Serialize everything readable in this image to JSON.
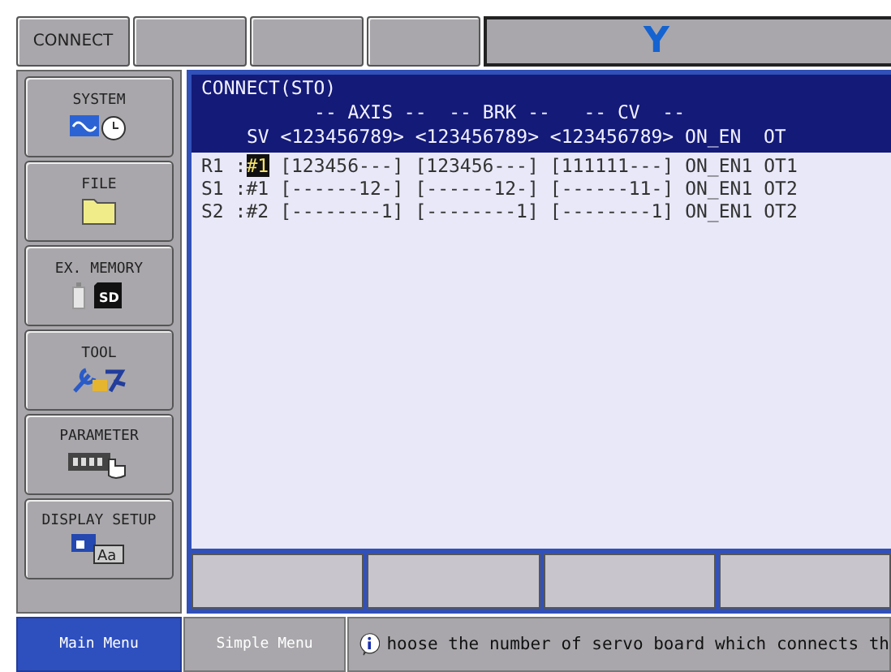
{
  "top_bar": {
    "connect_button": "CONNECT",
    "title": "Y"
  },
  "menu": [
    {
      "label": "SYSTEM",
      "kind": "system"
    },
    {
      "label": "FILE",
      "kind": "file"
    },
    {
      "label": "EX. MEMORY",
      "kind": "memory",
      "icon_text": "SD"
    },
    {
      "label": "TOOL",
      "kind": "tool"
    },
    {
      "label": "PARAMETER",
      "kind": "parameter"
    },
    {
      "label": "DISPLAY SETUP",
      "kind": "display",
      "icon_text": "Aa"
    }
  ],
  "panel": {
    "title": "CONNECT(STO)",
    "header_groups": "-- AXIS --  -- BRK --   -- CV  --",
    "header_columns": "SV <123456789> <123456789> <123456789> ON_EN  OT",
    "rows": [
      {
        "robot": "R1 :",
        "sv": "#1",
        "axis": "[123456---]",
        "brk": "[123456---]",
        "cv": "[111111---]",
        "on_en": "ON_EN1",
        "ot": "OT1",
        "selected": true
      },
      {
        "robot": "S1 :",
        "sv": "#1",
        "axis": "[------12-]",
        "brk": "[------12-]",
        "cv": "[------11-]",
        "on_en": "ON_EN1",
        "ot": "OT2",
        "selected": false
      },
      {
        "robot": "S2 :",
        "sv": "#2",
        "axis": "[--------1]",
        "brk": "[--------1]",
        "cv": "[--------1]",
        "on_en": "ON_EN1",
        "ot": "OT2",
        "selected": false
      }
    ]
  },
  "bottom_bar": {
    "tabs": [
      {
        "label": "Main Menu",
        "selected": true
      },
      {
        "label": "Simple Menu",
        "selected": false
      }
    ],
    "message": "hoose the number of servo board which connects th"
  }
}
